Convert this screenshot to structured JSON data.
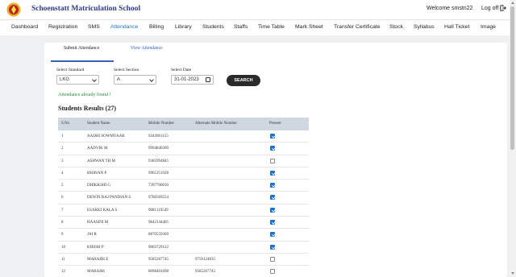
{
  "header": {
    "school_name": "Schoenstatt Matriculation School",
    "welcome": "Welcome smstn22",
    "logoff": "Log off"
  },
  "nav": [
    "Dashboard",
    "Registration",
    "SMS",
    "Attendance",
    "Billing",
    "Library",
    "Students",
    "Staffs",
    "Time Table",
    "Mark Sheet",
    "Transfer Certificate",
    "Stock",
    "Syllabus",
    "Hall Ticket",
    "Image"
  ],
  "nav_active": "Attendance",
  "tabs": {
    "submit": "Submit Attendance",
    "view": "View Attendance"
  },
  "filters": {
    "standard_label": "Select Standard",
    "standard_value": "LKG",
    "section_label": "Select Section",
    "section_value": "A",
    "date_label": "Select Date",
    "date_value": "31-01-2023"
  },
  "search_label": "SEARCH",
  "found_message": "Attendance already found !",
  "results_title": "Students Results (27)",
  "table": {
    "headers": [
      "S.No",
      "Student Name",
      "Mobile Number",
      "Alternate Mobile Number",
      "Present"
    ],
    "rows": [
      {
        "sno": "1",
        "name": "AADHI SOWMYAAB",
        "mobile": "9344961155",
        "alt": "",
        "present": true
      },
      {
        "sno": "2",
        "name": "AADVIK M",
        "mobile": "9994846309",
        "alt": "",
        "present": true
      },
      {
        "sno": "3",
        "name": "ASHWAN TH M",
        "mobile": "9385994845",
        "alt": "",
        "present": false
      },
      {
        "sno": "4",
        "name": "BHAVAN P",
        "mobile": "9965351928",
        "alt": "",
        "present": true
      },
      {
        "sno": "5",
        "name": "DHIKKSHI G",
        "mobile": "7397700030",
        "alt": "",
        "present": true
      },
      {
        "sno": "6",
        "name": "DEWIN RAJ PANDIAN S",
        "mobile": "9786569554",
        "alt": "",
        "present": true
      },
      {
        "sno": "7",
        "name": "ESAKKI KALA S",
        "mobile": "9081119549",
        "alt": "",
        "present": true
      },
      {
        "sno": "8",
        "name": "HAASINI M",
        "mobile": "9842144405",
        "alt": "",
        "present": true
      },
      {
        "sno": "9",
        "name": "JAI R",
        "mobile": "8870559369",
        "alt": "",
        "present": true
      },
      {
        "sno": "10",
        "name": "KIRISH P",
        "mobile": "9003729122",
        "alt": "",
        "present": true
      },
      {
        "sno": "11",
        "name": "MAHAIRI E",
        "mobile": "9585267745",
        "alt": "9750124835",
        "present": false
      },
      {
        "sno": "12",
        "name": "MAHAIRI",
        "mobile": "8098401698",
        "alt": "9585267745",
        "present": false
      }
    ]
  },
  "colors": {
    "brand": "#2d3a8c",
    "active_nav": "#1a73c8",
    "success": "#2b8a3e",
    "check": "#1a6fd6",
    "table_head": "#cfd8e0"
  }
}
